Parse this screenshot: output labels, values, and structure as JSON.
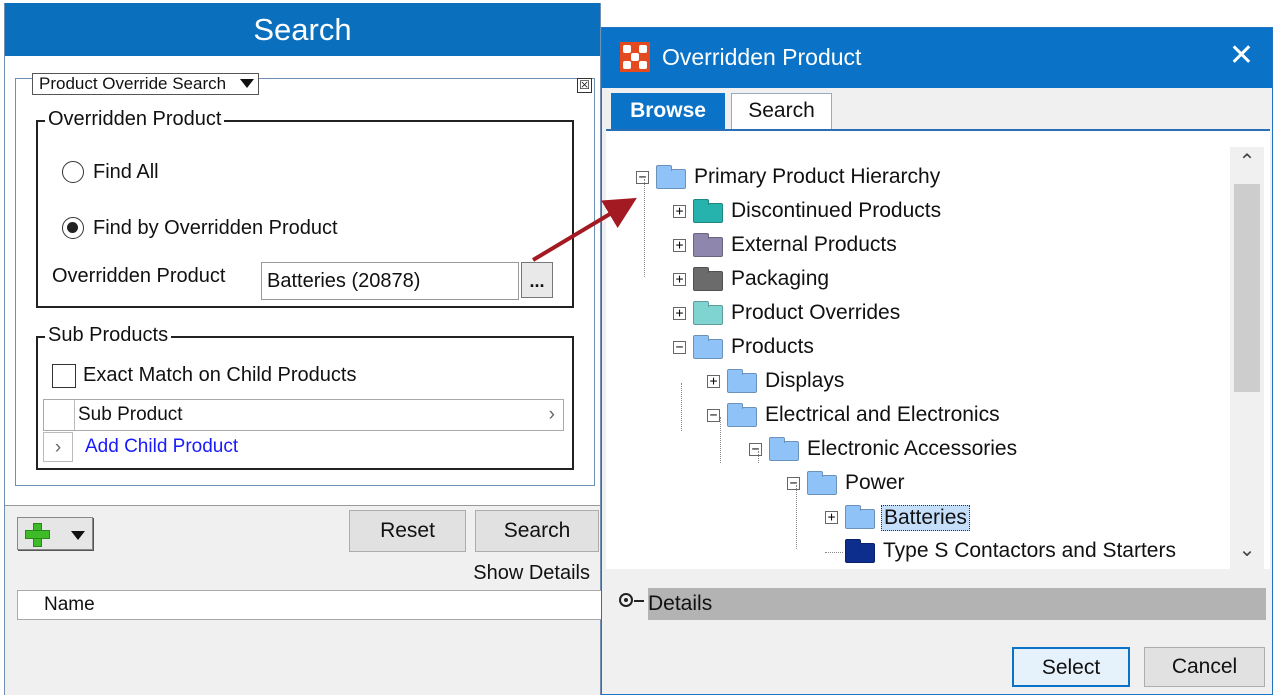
{
  "left_panel": {
    "title": "Search",
    "search_type": "Product Override Search",
    "close_glyph": "☒",
    "overridden_group": {
      "legend": "Overridden Product",
      "find_all": "Find All",
      "find_by": "Find by Overridden Product",
      "field_label": "Overridden Product",
      "field_value": "Batteries (20878)",
      "browse_button": "..."
    },
    "sub_products_group": {
      "legend": "Sub Products",
      "exact_match": "Exact Match on Child Products",
      "grid_header": "Sub Product",
      "add_child": "Add Child Product"
    },
    "buttons": {
      "reset": "Reset",
      "search": "Search"
    },
    "show_details": "Show Details",
    "results_header": "Name"
  },
  "dialog": {
    "title": "Overridden Product",
    "close_glyph": "✕",
    "tabs": [
      {
        "label": "Browse",
        "active": true
      },
      {
        "label": "Search",
        "active": false
      }
    ],
    "tree": [
      {
        "label": "Primary Product Hierarchy",
        "expander": "−",
        "color": "#8fc3f7"
      },
      {
        "label": "Discontinued Products",
        "expander": "+",
        "color": "#27b3ad"
      },
      {
        "label": "External Products",
        "expander": "+",
        "color": "#8e86ad"
      },
      {
        "label": "Packaging",
        "expander": "+",
        "color": "#6b6b6b"
      },
      {
        "label": "Product Overrides",
        "expander": "+",
        "color": "#7fd3d0"
      },
      {
        "label": "Products",
        "expander": "−",
        "color": "#8fc3f7"
      },
      {
        "label": "Displays",
        "expander": "+",
        "color": "#8fc3f7"
      },
      {
        "label": "Electrical and Electronics",
        "expander": "−",
        "color": "#8fc3f7"
      },
      {
        "label": "Electronic Accessories",
        "expander": "−",
        "color": "#8fc3f7"
      },
      {
        "label": "Power",
        "expander": "−",
        "color": "#8fc3f7"
      },
      {
        "label": "Batteries",
        "expander": "+",
        "color": "#8fc3f7",
        "selected": true
      },
      {
        "label": "Type S Contactors and Starters",
        "expander": "",
        "color": "#0e2e8e"
      }
    ],
    "scroll_up": "⌃",
    "scroll_down": "⌄",
    "details_label": "Details",
    "buttons": {
      "select": "Select",
      "cancel": "Cancel"
    }
  },
  "colors": {
    "accent": "#0a73c7",
    "arrow": "#a31a22",
    "selection": "#c5defa"
  }
}
